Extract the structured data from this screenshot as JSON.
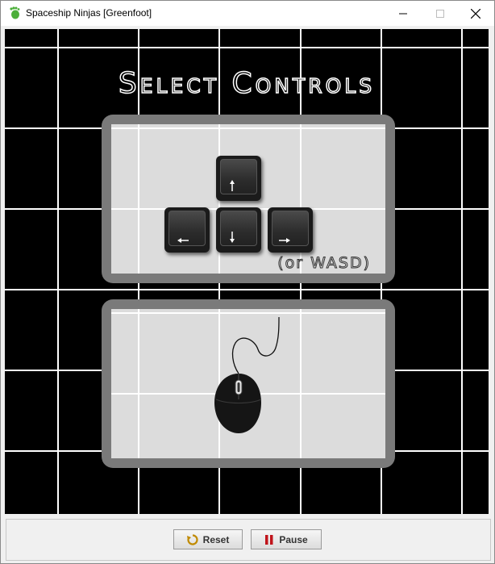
{
  "window": {
    "title": "Spaceship Ninjas [Greenfoot]",
    "app_icon": "greenfoot-foot-icon",
    "controls": [
      "minimize-icon",
      "maximize-icon",
      "close-icon"
    ]
  },
  "world": {
    "heading": "Select Controls",
    "keyboard_panel": {
      "keys": [
        {
          "name": "up-arrow-key",
          "arrow": "up"
        },
        {
          "name": "left-arrow-key",
          "arrow": "left"
        },
        {
          "name": "down-arrow-key",
          "arrow": "down"
        },
        {
          "name": "right-arrow-key",
          "arrow": "right"
        }
      ],
      "alt_text": "(or WASD)"
    },
    "mouse_panel": {
      "icon": "mouse-icon"
    }
  },
  "controls_bar": {
    "reset_label": "Reset",
    "pause_label": "Pause",
    "reset_icon": "reset-icon",
    "pause_icon": "pause-icon",
    "pause_icon_color": "#c0141b"
  },
  "colors": {
    "world_bg": "#000000",
    "grid_line": "#ffffff",
    "panel_frame": "#7a7a7a",
    "panel_fill": "#dcdcdc"
  }
}
